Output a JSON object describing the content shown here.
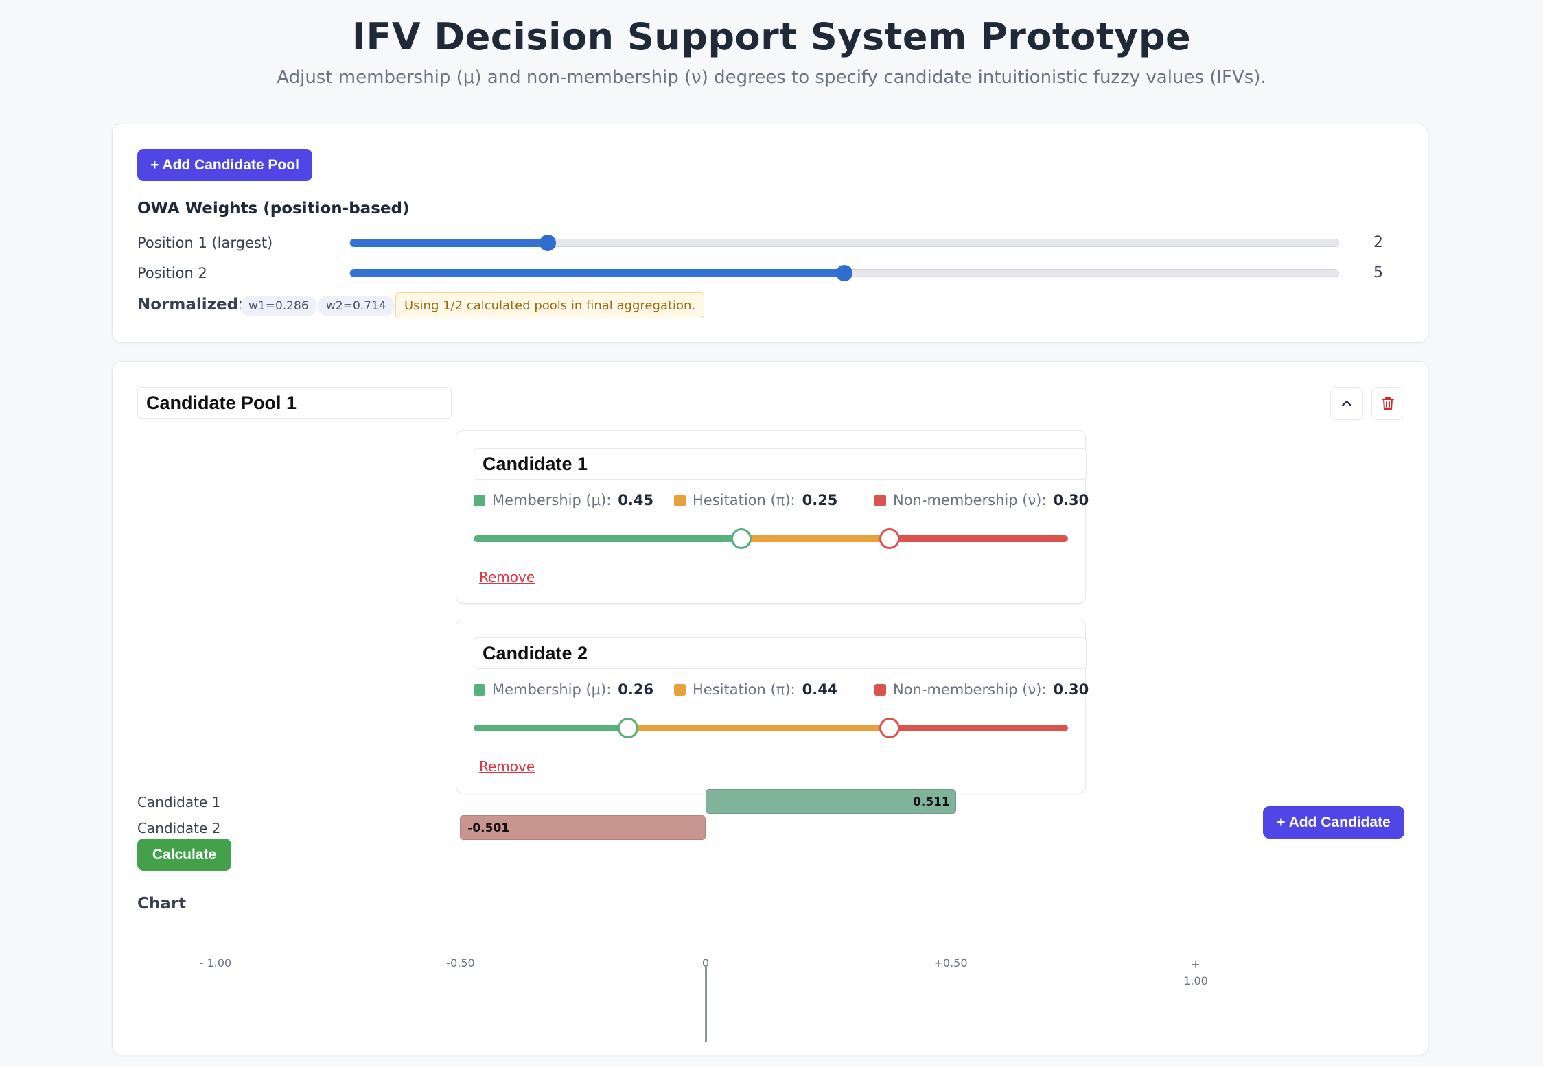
{
  "header": {
    "title": "IFV Decision Support System Prototype",
    "subtitle": "Adjust membership (μ) and non-membership (ν) degrees to specify candidate intuitionistic fuzzy values (IFVs)."
  },
  "settings": {
    "add_pool_label": "+ Add Candidate Pool",
    "owa_heading": "OWA Weights (position-based)",
    "positions": [
      {
        "label": "Position 1 (largest)",
        "value": "2",
        "fraction": 0.2
      },
      {
        "label": "Position 2",
        "value": "5",
        "fraction": 0.5
      }
    ],
    "normalized_label": "Normalized:",
    "chips": [
      "w1=0.286",
      "w2=0.714"
    ],
    "notice": "Using 1/2 calculated pools in final aggregation."
  },
  "pool": {
    "name": "Candidate Pool 1",
    "candidates": [
      {
        "name": "Candidate 1",
        "membership_label": "Membership (μ):",
        "membership": "0.45",
        "hesitation_label": "Hesitation (π):",
        "hesitation": "0.25",
        "nonmembership_label": "Non-membership (ν):",
        "nonmembership": "0.30",
        "remove_label": "Remove"
      },
      {
        "name": "Candidate 2",
        "membership_label": "Membership (μ):",
        "membership": "0.26",
        "hesitation_label": "Hesitation (π):",
        "hesitation": "0.44",
        "nonmembership_label": "Non-membership (ν):",
        "nonmembership": "0.30",
        "remove_label": "Remove"
      }
    ],
    "add_candidate_label": "+ Add Candidate",
    "calculate_label": "Calculate",
    "chart_heading": "Chart"
  },
  "colors": {
    "membership": "#58b07d",
    "hesitation": "#e9a23b",
    "nonmembership": "#d9534f",
    "primary": "#4f46e5",
    "success": "#43a04b",
    "bar_positive": "#7fb39a",
    "bar_negative": "#c9968f"
  },
  "icons": {
    "collapse": "chevron-up-icon",
    "delete": "trash-icon"
  },
  "chart_data": {
    "type": "bar",
    "orientation": "horizontal",
    "categories": [
      "Candidate 1",
      "Candidate 2"
    ],
    "values": [
      0.511,
      -0.501
    ],
    "value_labels": [
      "0.511",
      "-0.501"
    ],
    "xlim": [
      -1.0,
      1.0
    ],
    "tick_labels": [
      "- 1.00",
      "-0.50",
      "0",
      "+0.50",
      "+ 1.00"
    ],
    "ticks": [
      -1.0,
      -0.5,
      0,
      0.5,
      1.0
    ],
    "grid": true
  }
}
